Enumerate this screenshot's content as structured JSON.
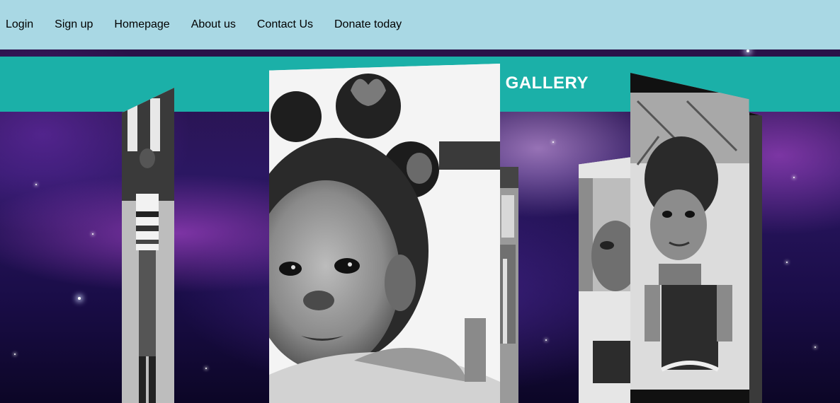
{
  "nav": {
    "items": [
      {
        "label": "Login"
      },
      {
        "label": "Sign up"
      },
      {
        "label": "Homepage"
      },
      {
        "label": "About us"
      },
      {
        "label": "Contact Us"
      },
      {
        "label": "Donate today"
      }
    ]
  },
  "banner": {
    "title": "S GALLERY"
  },
  "colors": {
    "navbar": "#a9d8e4",
    "banner": "#1bb0a8",
    "banner_text": "#ffffff"
  },
  "gallery": {
    "photos": [
      {
        "name": "photo-left",
        "description": "child standing outdoors"
      },
      {
        "name": "photo-mid-back",
        "description": "partial photo"
      },
      {
        "name": "photo-center",
        "description": "baby portrait with hair bows"
      },
      {
        "name": "photo-right-back",
        "description": "baby in highchair"
      },
      {
        "name": "photo-right",
        "description": "toddler in dress"
      }
    ]
  }
}
